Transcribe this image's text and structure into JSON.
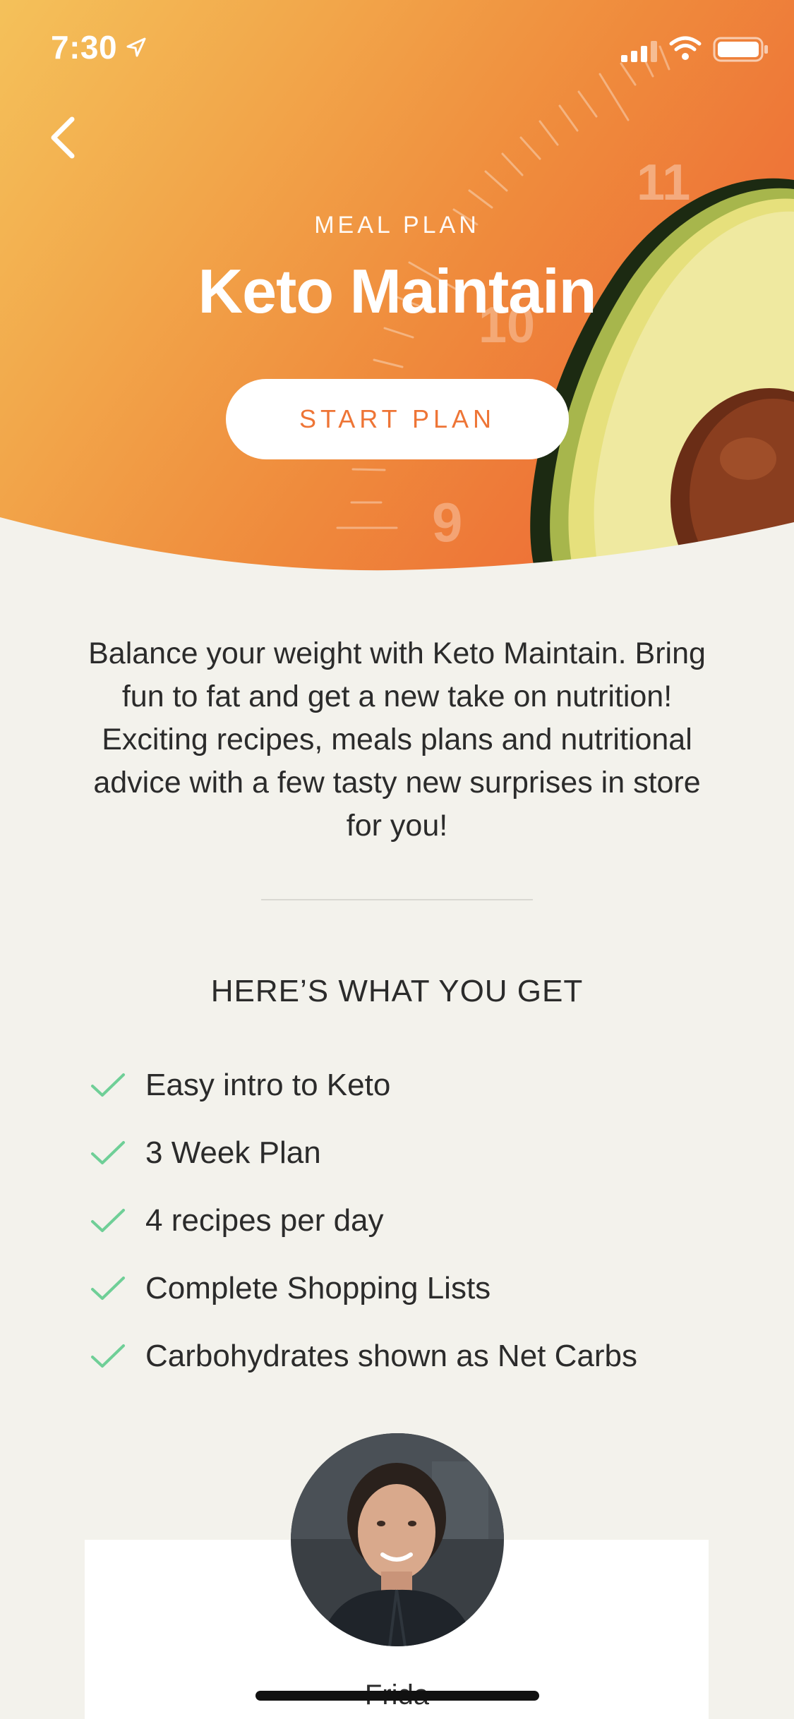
{
  "status_bar": {
    "time": "7:30",
    "location_icon": "location-arrow-icon",
    "signal_icon": "cellular-signal-icon",
    "wifi_icon": "wifi-icon",
    "battery_icon": "battery-icon"
  },
  "header": {
    "back_icon": "chevron-left-icon",
    "eyebrow": "MEAL PLAN",
    "title": "Keto Maintain",
    "start_button_label": "START PLAN",
    "clock_numbers": [
      "11",
      "10",
      "9"
    ]
  },
  "colors": {
    "gradient_start": "#f4c15a",
    "gradient_end": "#ec6a36",
    "accent": "#ee7536",
    "check": "#6fcf97",
    "background": "#f3f2ec",
    "text": "#2b2b2b"
  },
  "description": "Balance your weight with Keto Maintain. Bring fun to fat and get a new take on nutrition! Exciting recipes, meals plans and nutritional advice with a few tasty new surprises in store for you!",
  "benefits": {
    "title": "HERE’S WHAT YOU GET",
    "check_icon": "checkmark-icon",
    "items": [
      "Easy intro to Keto",
      "3 Week Plan",
      "4 recipes per day",
      "Complete Shopping Lists",
      "Carbohydrates shown as Net Carbs"
    ]
  },
  "coach": {
    "name": "Frida",
    "avatar_icon": "coach-avatar"
  }
}
